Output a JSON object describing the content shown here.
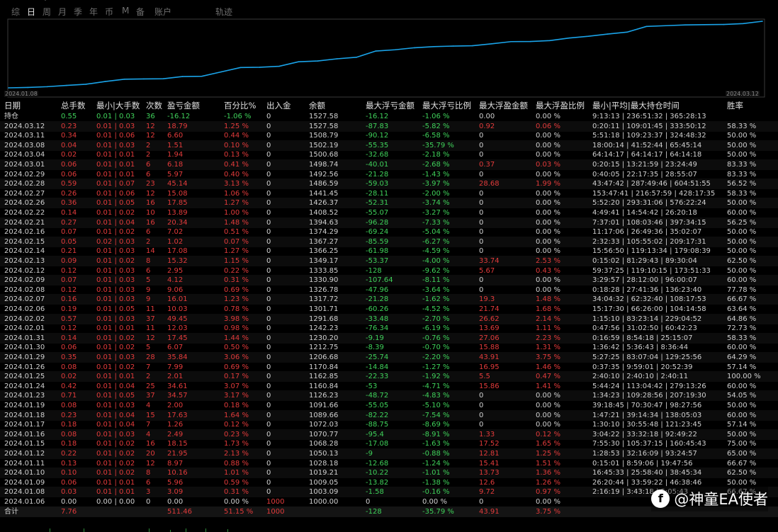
{
  "tabs": [
    {
      "label": "综",
      "active": false
    },
    {
      "label": "日",
      "active": true
    },
    {
      "label": "周",
      "active": false
    },
    {
      "label": "月",
      "active": false
    },
    {
      "label": "季",
      "active": false
    },
    {
      "label": "年",
      "active": false
    },
    {
      "label": "币",
      "active": false
    },
    {
      "label": "M",
      "active": false
    },
    {
      "label": "备",
      "active": false
    },
    {
      "label": "账户",
      "active": false
    },
    {
      "label": "轨迹",
      "active": false
    }
  ],
  "chart_data": {
    "type": "line",
    "x_start": "2024.01.08",
    "x_end": "2024.03.12",
    "x": [
      "2024.01.06",
      "2024.01.08",
      "2024.01.09",
      "2024.01.10",
      "2024.01.11",
      "2024.01.12",
      "2024.01.15",
      "2024.01.16",
      "2024.01.17",
      "2024.01.18",
      "2024.01.19",
      "2024.01.23",
      "2024.01.24",
      "2024.01.25",
      "2024.01.26",
      "2024.01.29",
      "2024.01.30",
      "2024.01.31",
      "2024.02.01",
      "2024.02.02",
      "2024.02.06",
      "2024.02.07",
      "2024.02.08",
      "2024.02.09",
      "2024.02.12",
      "2024.02.13",
      "2024.02.14",
      "2024.02.15",
      "2024.02.16",
      "2024.02.21",
      "2024.02.22",
      "2024.02.26",
      "2024.02.27",
      "2024.02.28",
      "2024.02.29",
      "2024.03.01",
      "2024.03.04",
      "2024.03.08",
      "2024.03.11",
      "2024.03.12"
    ],
    "series": [
      {
        "color": "#1aa3e8",
        "values": [
          1000.0,
          1003.09,
          1009.05,
          1019.21,
          1028.18,
          1050.13,
          1068.28,
          1070.77,
          1072.03,
          1089.66,
          1091.66,
          1126.23,
          1160.84,
          1162.85,
          1170.84,
          1206.68,
          1212.75,
          1230.2,
          1242.23,
          1291.68,
          1301.71,
          1317.72,
          1326.78,
          1330.9,
          1333.85,
          1349.17,
          1366.25,
          1367.27,
          1374.29,
          1394.63,
          1408.52,
          1426.37,
          1441.45,
          1486.59,
          1492.56,
          1498.74,
          1500.68,
          1502.19,
          1508.79,
          1527.58
        ]
      }
    ]
  },
  "columns": [
    "日期",
    "总手数",
    "最小|大手数",
    "次数",
    "盈亏金额",
    "百分比%",
    "出入金",
    "余额",
    "最大浮亏金额",
    "最大浮亏比例",
    "最大浮盈金额",
    "最大浮盈比例",
    "最小|平均|最大持仓时间",
    "胜率"
  ],
  "holding": {
    "date": "持仓",
    "lots": "0.55",
    "minmax": "0.01 | 0.03",
    "count": "36",
    "pnl": "-16.12",
    "pct": "-1.06 %",
    "io": "0",
    "bal": "1527.58",
    "fl": "-16.12",
    "flp": "-1.06 %",
    "fp": "0.00",
    "fpp": "0.00 %",
    "time": "9:13:13 | 236:51:32 | 365:28:13",
    "win": ""
  },
  "rows": [
    {
      "date": "2024.03.12",
      "lots": "0.23",
      "minmax": "0.01 | 0.03",
      "count": "12",
      "pnl": "18.79",
      "pct": "1.25 %",
      "io": "0",
      "bal": "1527.58",
      "fl": "-87.83",
      "flp": "-5.82 %",
      "fp": "0.92",
      "fpp": "0.06 %",
      "time": "0:20:11 | 109:01:45 | 333:50:12",
      "win": "58.33 %"
    },
    {
      "date": "2024.03.11",
      "lots": "0.34",
      "minmax": "0.01 | 0.06",
      "count": "12",
      "pnl": "6.60",
      "pct": "0.44 %",
      "io": "0",
      "bal": "1508.79",
      "fl": "-90.12",
      "flp": "-6.58 %",
      "fp": "0",
      "fpp": "0.00 %",
      "time": "5:51:18 | 109:23:37 | 324:48:32",
      "win": "50.00 %"
    },
    {
      "date": "2024.03.08",
      "lots": "0.04",
      "minmax": "0.01 | 0.03",
      "count": "2",
      "pnl": "1.51",
      "pct": "0.10 %",
      "io": "0",
      "bal": "1502.19",
      "fl": "-55.35",
      "flp": "-35.79 %",
      "fp": "0",
      "fpp": "0.00 %",
      "time": "18:00:14 | 41:52:44 | 65:45:14",
      "win": "50.00 %"
    },
    {
      "date": "2024.03.04",
      "lots": "0.02",
      "minmax": "0.01 | 0.01",
      "count": "2",
      "pnl": "1.94",
      "pct": "0.13 %",
      "io": "0",
      "bal": "1500.68",
      "fl": "-32.68",
      "flp": "-2.18 %",
      "fp": "0",
      "fpp": "0.00 %",
      "time": "64:14:17 | 64:14:17 | 64:14:18",
      "win": "50.00 %"
    },
    {
      "date": "2024.03.01",
      "lots": "0.06",
      "minmax": "0.01 | 0.01",
      "count": "6",
      "pnl": "6.18",
      "pct": "0.41 %",
      "io": "0",
      "bal": "1498.74",
      "fl": "-40.01",
      "flp": "-2.68 %",
      "fp": "0.37",
      "fpp": "0.03 %",
      "time": "0:20:15 | 13:21:59 | 23:24:49",
      "win": "83.33 %"
    },
    {
      "date": "2024.02.29",
      "lots": "0.06",
      "minmax": "0.01 | 0.01",
      "count": "6",
      "pnl": "5.97",
      "pct": "0.40 %",
      "io": "0",
      "bal": "1492.56",
      "fl": "-21.28",
      "flp": "-1.43 %",
      "fp": "0",
      "fpp": "0.00 %",
      "time": "0:40:05 | 22:17:35 | 28:55:07",
      "win": "83.33 %"
    },
    {
      "date": "2024.02.28",
      "lots": "0.59",
      "minmax": "0.01 | 0.07",
      "count": "23",
      "pnl": "45.14",
      "pct": "3.13 %",
      "io": "0",
      "bal": "1486.59",
      "fl": "-59.03",
      "flp": "-3.97 %",
      "fp": "28.68",
      "fpp": "1.99 %",
      "time": "43:47:42 | 287:49:46 | 604:51:55",
      "win": "56.52 %"
    },
    {
      "date": "2024.02.27",
      "lots": "0.26",
      "minmax": "0.01 | 0.06",
      "count": "12",
      "pnl": "15.08",
      "pct": "1.06 %",
      "io": "0",
      "bal": "1441.45",
      "fl": "-28.11",
      "flp": "-2.00 %",
      "fp": "0",
      "fpp": "0.00 %",
      "time": "153:47:41 | 216:57:59 | 428:17:35",
      "win": "58.33 %"
    },
    {
      "date": "2024.02.26",
      "lots": "0.36",
      "minmax": "0.01 | 0.05",
      "count": "16",
      "pnl": "17.85",
      "pct": "1.27 %",
      "io": "0",
      "bal": "1426.37",
      "fl": "-52.31",
      "flp": "-3.74 %",
      "fp": "0",
      "fpp": "0.00 %",
      "time": "5:52:20 | 293:31:06 | 576:22:24",
      "win": "50.00 %"
    },
    {
      "date": "2024.02.22",
      "lots": "0.14",
      "minmax": "0.01 | 0.02",
      "count": "10",
      "pnl": "13.89",
      "pct": "1.00 %",
      "io": "0",
      "bal": "1408.52",
      "fl": "-55.07",
      "flp": "-3.27 %",
      "fp": "0",
      "fpp": "0.00 %",
      "time": "4:49:41 | 14:54:42 | 26:20:18",
      "win": "60.00 %"
    },
    {
      "date": "2024.02.21",
      "lots": "0.27",
      "minmax": "0.01 | 0.04",
      "count": "16",
      "pnl": "20.34",
      "pct": "1.48 %",
      "io": "0",
      "bal": "1394.63",
      "fl": "-96.28",
      "flp": "-7.33 %",
      "fp": "0",
      "fpp": "0.00 %",
      "time": "7:37:01 | 108:03:46 | 397:34:15",
      "win": "56.25 %"
    },
    {
      "date": "2024.02.16",
      "lots": "0.07",
      "minmax": "0.01 | 0.02",
      "count": "6",
      "pnl": "7.02",
      "pct": "0.51 %",
      "io": "0",
      "bal": "1374.29",
      "fl": "-69.24",
      "flp": "-5.04 %",
      "fp": "0",
      "fpp": "0.00 %",
      "time": "11:17:06 | 26:49:36 | 35:02:07",
      "win": "50.00 %"
    },
    {
      "date": "2024.02.15",
      "lots": "0.05",
      "minmax": "0.02 | 0.03",
      "count": "2",
      "pnl": "1.02",
      "pct": "0.07 %",
      "io": "0",
      "bal": "1367.27",
      "fl": "-85.59",
      "flp": "-6.27 %",
      "fp": "0",
      "fpp": "0.00 %",
      "time": "2:32:33 | 105:55:02 | 209:17:31",
      "win": "50.00 %"
    },
    {
      "date": "2024.02.14",
      "lots": "0.21",
      "minmax": "0.01 | 0.03",
      "count": "14",
      "pnl": "17.08",
      "pct": "1.27 %",
      "io": "0",
      "bal": "1366.25",
      "fl": "-61.98",
      "flp": "-4.59 %",
      "fp": "0",
      "fpp": "0.00 %",
      "time": "15:56:50 | 119:13:34 | 179:08:39",
      "win": "50.00 %"
    },
    {
      "date": "2024.02.13",
      "lots": "0.09",
      "minmax": "0.01 | 0.02",
      "count": "8",
      "pnl": "15.32",
      "pct": "1.15 %",
      "io": "0",
      "bal": "1349.17",
      "fl": "-53.37",
      "flp": "-4.00 %",
      "fp": "33.74",
      "fpp": "2.53 %",
      "time": "0:15:02 | 81:29:43 | 89:30:04",
      "win": "62.50 %"
    },
    {
      "date": "2024.02.12",
      "lots": "0.12",
      "minmax": "0.01 | 0.03",
      "count": "6",
      "pnl": "2.95",
      "pct": "0.22 %",
      "io": "0",
      "bal": "1333.85",
      "fl": "-128",
      "flp": "-9.62 %",
      "fp": "5.67",
      "fpp": "0.43 %",
      "time": "59:37:25 | 119:10:15 | 173:51:33",
      "win": "50.00 %"
    },
    {
      "date": "2024.02.09",
      "lots": "0.07",
      "minmax": "0.01 | 0.03",
      "count": "5",
      "pnl": "4.12",
      "pct": "0.31 %",
      "io": "0",
      "bal": "1330.90",
      "fl": "-107.64",
      "flp": "-8.11 %",
      "fp": "0",
      "fpp": "0.00 %",
      "time": "3:29:57 | 28:12:00 | 96:00:07",
      "win": "60.00 %"
    },
    {
      "date": "2024.02.08",
      "lots": "0.12",
      "minmax": "0.01 | 0.03",
      "count": "9",
      "pnl": "9.06",
      "pct": "0.69 %",
      "io": "0",
      "bal": "1326.78",
      "fl": "-47.96",
      "flp": "-3.64 %",
      "fp": "0",
      "fpp": "0.00 %",
      "time": "0:18:28 | 27:41:36 | 136:23:40",
      "win": "77.78 %"
    },
    {
      "date": "2024.02.07",
      "lots": "0.16",
      "minmax": "0.01 | 0.03",
      "count": "9",
      "pnl": "16.01",
      "pct": "1.23 %",
      "io": "0",
      "bal": "1317.72",
      "fl": "-21.28",
      "flp": "-1.62 %",
      "fp": "19.3",
      "fpp": "1.48 %",
      "time": "34:04:32 | 62:32:40 | 108:17:53",
      "win": "66.67 %"
    },
    {
      "date": "2024.02.06",
      "lots": "0.19",
      "minmax": "0.01 | 0.05",
      "count": "11",
      "pnl": "10.03",
      "pct": "0.78 %",
      "io": "0",
      "bal": "1301.71",
      "fl": "-60.26",
      "flp": "-4.52 %",
      "fp": "21.74",
      "fpp": "1.68 %",
      "time": "15:17:30 | 66:26:00 | 104:14:58",
      "win": "63.64 %"
    },
    {
      "date": "2024.02.02",
      "lots": "0.57",
      "minmax": "0.01 | 0.03",
      "count": "37",
      "pnl": "49.45",
      "pct": "3.98 %",
      "io": "0",
      "bal": "1291.68",
      "fl": "-33.48",
      "flp": "-2.70 %",
      "fp": "26.62",
      "fpp": "2.14 %",
      "time": "1:15:10 | 83:23:14 | 229:04:52",
      "win": "64.86 %"
    },
    {
      "date": "2024.02.01",
      "lots": "0.12",
      "minmax": "0.01 | 0.01",
      "count": "11",
      "pnl": "12.03",
      "pct": "0.98 %",
      "io": "0",
      "bal": "1242.23",
      "fl": "-76.34",
      "flp": "-6.19 %",
      "fp": "13.69",
      "fpp": "1.11 %",
      "time": "0:47:56 | 31:02:50 | 60:42:23",
      "win": "72.73 %"
    },
    {
      "date": "2024.01.31",
      "lots": "0.14",
      "minmax": "0.01 | 0.02",
      "count": "12",
      "pnl": "17.45",
      "pct": "1.44 %",
      "io": "0",
      "bal": "1230.20",
      "fl": "-9.19",
      "flp": "-0.76 %",
      "fp": "27.06",
      "fpp": "2.23 %",
      "time": "0:16:59 | 8:54:18 | 25:15:07",
      "win": "58.33 %"
    },
    {
      "date": "2024.01.30",
      "lots": "0.06",
      "minmax": "0.01 | 0.02",
      "count": "5",
      "pnl": "6.07",
      "pct": "0.50 %",
      "io": "0",
      "bal": "1212.75",
      "fl": "-8.39",
      "flp": "-0.70 %",
      "fp": "15.88",
      "fpp": "1.31 %",
      "time": "1:36:42 | 5:36:43 | 8:36:44",
      "win": "60.00 %"
    },
    {
      "date": "2024.01.29",
      "lots": "0.35",
      "minmax": "0.01 | 0.03",
      "count": "28",
      "pnl": "35.84",
      "pct": "3.06 %",
      "io": "0",
      "bal": "1206.68",
      "fl": "-25.74",
      "flp": "-2.20 %",
      "fp": "43.91",
      "fpp": "3.75 %",
      "time": "5:27:25 | 83:07:04 | 129:25:56",
      "win": "64.29 %"
    },
    {
      "date": "2024.01.26",
      "lots": "0.08",
      "minmax": "0.01 | 0.02",
      "count": "7",
      "pnl": "7.99",
      "pct": "0.69 %",
      "io": "0",
      "bal": "1170.84",
      "fl": "-14.84",
      "flp": "-1.27 %",
      "fp": "16.95",
      "fpp": "1.46 %",
      "time": "0:37:35 | 9:59:01 | 20:52:39",
      "win": "57.14 %"
    },
    {
      "date": "2024.01.25",
      "lots": "0.02",
      "minmax": "0.01 | 0.01",
      "count": "2",
      "pnl": "2.01",
      "pct": "0.17 %",
      "io": "0",
      "bal": "1162.85",
      "fl": "-22.33",
      "flp": "-1.92 %",
      "fp": "5.5",
      "fpp": "0.47 %",
      "time": "2:40:10 | 2:40:10 | 2:40:11",
      "win": "100.00 %"
    },
    {
      "date": "2024.01.24",
      "lots": "0.42",
      "minmax": "0.01 | 0.04",
      "count": "25",
      "pnl": "34.61",
      "pct": "3.07 %",
      "io": "0",
      "bal": "1160.84",
      "fl": "-53",
      "flp": "-4.71 %",
      "fp": "15.86",
      "fpp": "1.41 %",
      "time": "5:44:24 | 113:04:42 | 279:13:26",
      "win": "60.00 %"
    },
    {
      "date": "2024.01.23",
      "lots": "0.71",
      "minmax": "0.01 | 0.05",
      "count": "37",
      "pnl": "34.57",
      "pct": "3.17 %",
      "io": "0",
      "bal": "1126.23",
      "fl": "-48.72",
      "flp": "-4.83 %",
      "fp": "0",
      "fpp": "0.00 %",
      "time": "1:34:23 | 109:28:56 | 207:19:30",
      "win": "54.05 %"
    },
    {
      "date": "2024.01.19",
      "lots": "0.08",
      "minmax": "0.01 | 0.03",
      "count": "4",
      "pnl": "2.00",
      "pct": "0.18 %",
      "io": "0",
      "bal": "1091.66",
      "fl": "-55.05",
      "flp": "-5.10 %",
      "fp": "0",
      "fpp": "0.00 %",
      "time": "39:18:45 | 70:30:47 | 98:27:56",
      "win": "50.00 %"
    },
    {
      "date": "2024.01.18",
      "lots": "0.23",
      "minmax": "0.01 | 0.04",
      "count": "15",
      "pnl": "17.63",
      "pct": "1.64 %",
      "io": "0",
      "bal": "1089.66",
      "fl": "-82.22",
      "flp": "-7.54 %",
      "fp": "0",
      "fpp": "0.00 %",
      "time": "1:47:21 | 39:14:34 | 138:05:03",
      "win": "60.00 %"
    },
    {
      "date": "2024.01.17",
      "lots": "0.18",
      "minmax": "0.01 | 0.04",
      "count": "7",
      "pnl": "1.26",
      "pct": "0.12 %",
      "io": "0",
      "bal": "1072.03",
      "fl": "-88.75",
      "flp": "-8.69 %",
      "fp": "0",
      "fpp": "0.00 %",
      "time": "1:30:10 | 30:55:48 | 121:23:45",
      "win": "57.14 %"
    },
    {
      "date": "2024.01.16",
      "lots": "0.08",
      "minmax": "0.01 | 0.03",
      "count": "4",
      "pnl": "2.49",
      "pct": "0.23 %",
      "io": "0",
      "bal": "1070.77",
      "fl": "-95.4",
      "flp": "-8.91 %",
      "fp": "1.33",
      "fpp": "0.12 %",
      "time": "3:04:22 | 33:32:18 | 92:49:22",
      "win": "50.00 %"
    },
    {
      "date": "2024.01.15",
      "lots": "0.18",
      "minmax": "0.01 | 0.02",
      "count": "16",
      "pnl": "18.15",
      "pct": "1.73 %",
      "io": "0",
      "bal": "1068.28",
      "fl": "-17.08",
      "flp": "-1.63 %",
      "fp": "17.52",
      "fpp": "1.65 %",
      "time": "7:55:30 | 105:37:15 | 160:45:43",
      "win": "75.00 %"
    },
    {
      "date": "2024.01.12",
      "lots": "0.22",
      "minmax": "0.01 | 0.02",
      "count": "20",
      "pnl": "21.95",
      "pct": "2.13 %",
      "io": "0",
      "bal": "1050.13",
      "fl": "-9",
      "flp": "-0.88 %",
      "fp": "12.81",
      "fpp": "1.25 %",
      "time": "1:28:53 | 32:16:09 | 93:24:57",
      "win": "65.00 %"
    },
    {
      "date": "2024.01.11",
      "lots": "0.13",
      "minmax": "0.01 | 0.02",
      "count": "12",
      "pnl": "8.97",
      "pct": "0.88 %",
      "io": "0",
      "bal": "1028.18",
      "fl": "-12.68",
      "flp": "-1.24 %",
      "fp": "15.41",
      "fpp": "1.51 %",
      "time": "0:15:01 | 8:59:06 | 19:47:56",
      "win": "66.67 %"
    },
    {
      "date": "2024.01.10",
      "lots": "0.10",
      "minmax": "0.01 | 0.02",
      "count": "8",
      "pnl": "10.16",
      "pct": "1.01 %",
      "io": "0",
      "bal": "1019.21",
      "fl": "-10.22",
      "flp": "-1.01 %",
      "fp": "13.73",
      "fpp": "1.36 %",
      "time": "16:45:33 | 25:58:40 | 38:45:34",
      "win": "62.50 %"
    },
    {
      "date": "2024.01.09",
      "lots": "0.06",
      "minmax": "0.01 | 0.01",
      "count": "6",
      "pnl": "5.96",
      "pct": "0.59 %",
      "io": "0",
      "bal": "1009.05",
      "fl": "-13.82",
      "flp": "-1.38 %",
      "fp": "12.6",
      "fpp": "1.26 %",
      "time": "26:20:44 | 33:59:22 | 46:38:46",
      "win": "50.00 %"
    },
    {
      "date": "2024.01.08",
      "lots": "0.03",
      "minmax": "0.01 | 0.01",
      "count": "3",
      "pnl": "3.09",
      "pct": "0.31 %",
      "io": "0",
      "bal": "1003.09",
      "fl": "-1.58",
      "flp": "-0.16 %",
      "fp": "9.72",
      "fpp": "0.97 %",
      "time": "2:16:19 | 3:43:18 | 5:05:43",
      "win": "66.67 %"
    },
    {
      "date": "2024.01.06",
      "lots": "0.00",
      "minmax": "0.00 | 0.00",
      "count": "0",
      "pnl": "0.00",
      "pct": "0.00 %",
      "io": "1000",
      "bal": "1000.00",
      "fl": "0",
      "flp": "0.00 %",
      "fp": "0",
      "fpp": "0.00 %",
      "time": "",
      "win": ""
    }
  ],
  "total": {
    "date": "合计",
    "lots": "7.76",
    "minmax": "",
    "count": "",
    "pnl": "511.46",
    "pct": "51.15 %",
    "io": "1000",
    "bal": "",
    "fl": "-128",
    "flp": "-35.79 %",
    "fp": "43.91",
    "fpp": "3.75 %",
    "time": "",
    "win": ""
  },
  "watermark": {
    "icon": "f",
    "text": "@神童EA使者"
  }
}
